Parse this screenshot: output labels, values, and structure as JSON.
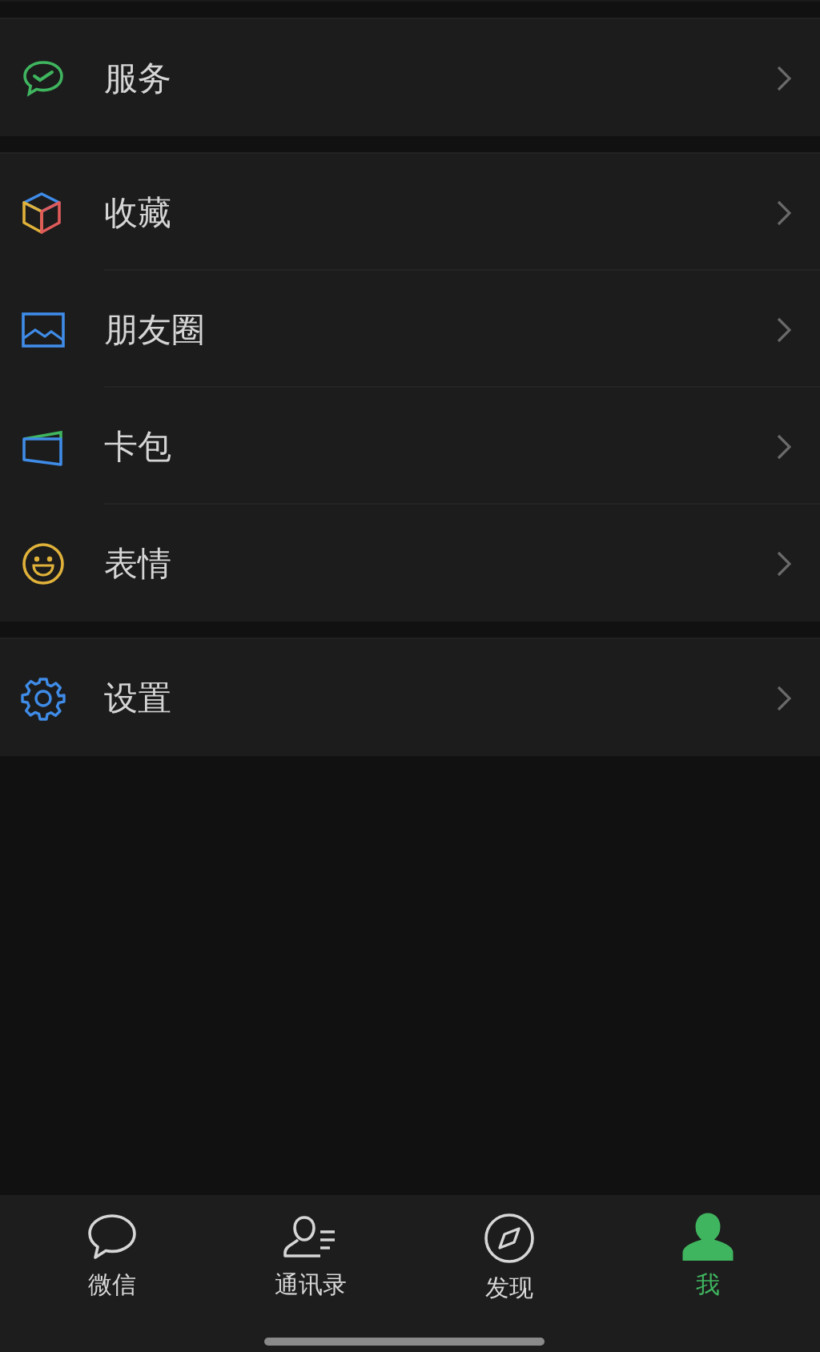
{
  "sections": [
    {
      "items": [
        {
          "kind": "service",
          "label": "服务"
        }
      ]
    },
    {
      "items": [
        {
          "kind": "favorites",
          "label": "收藏"
        },
        {
          "kind": "moments",
          "label": "朋友圈"
        },
        {
          "kind": "cards",
          "label": "卡包"
        },
        {
          "kind": "stickers",
          "label": "表情"
        }
      ]
    },
    {
      "items": [
        {
          "kind": "settings",
          "label": "设置"
        }
      ]
    }
  ],
  "tab_bar": [
    {
      "kind": "chats",
      "label": "微信",
      "selected": false
    },
    {
      "kind": "contacts",
      "label": "通讯录",
      "selected": false
    },
    {
      "kind": "discover",
      "label": "发现",
      "selected": false
    },
    {
      "kind": "me",
      "label": "我",
      "selected": true
    }
  ]
}
